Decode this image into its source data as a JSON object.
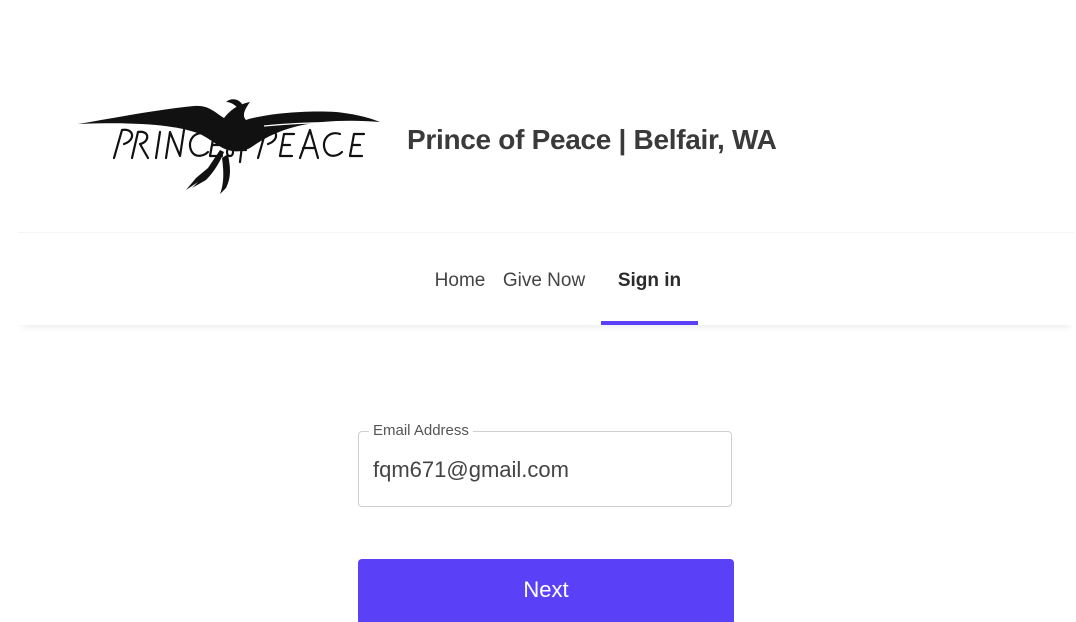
{
  "header": {
    "logo": {
      "icon": "dove-logo-icon",
      "text": "PRINCE of PEACE"
    },
    "site_title": "Prince of Peace | Belfair, WA"
  },
  "nav": {
    "tabs": [
      {
        "label": "Home",
        "active": false
      },
      {
        "label": "Give Now",
        "active": false
      },
      {
        "label": "Sign in",
        "active": true
      }
    ],
    "accent_color": "#5a41f8"
  },
  "form": {
    "email": {
      "label": "Email Address",
      "value": "fqm671@gmail.com"
    },
    "next_label": "Next",
    "button_color": "#5a41f8"
  }
}
